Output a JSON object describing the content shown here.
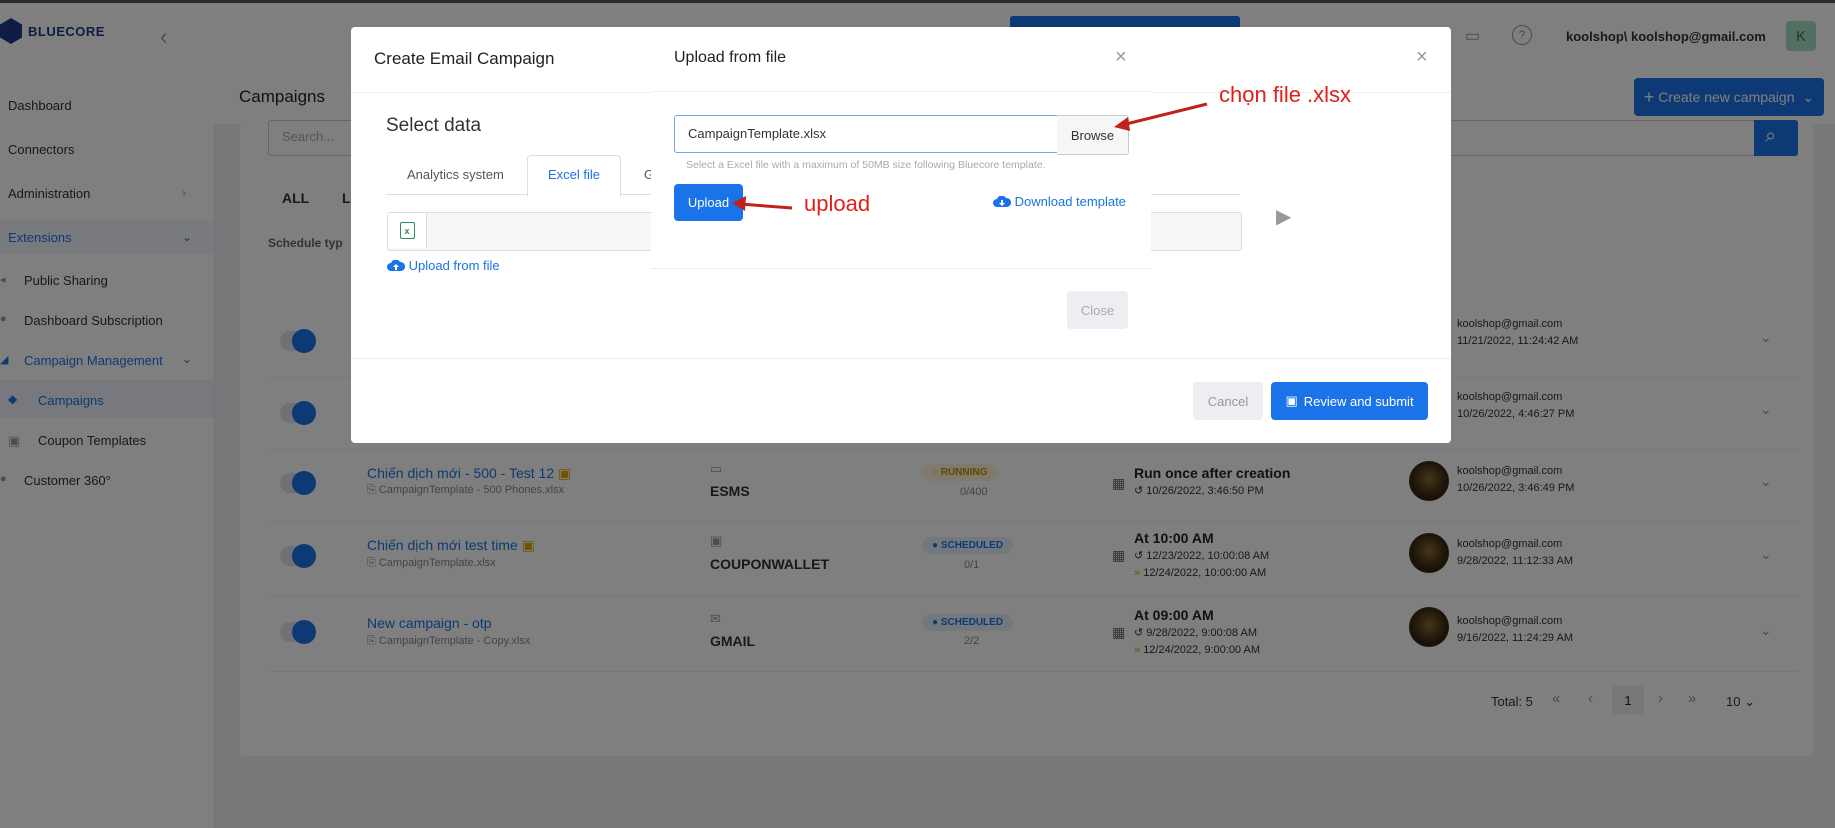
{
  "app": {
    "brand": "BLUECORE"
  },
  "header": {
    "user": "koolshop\\ koolshop@gmail.com",
    "avatar_letter": "K"
  },
  "sidebar": {
    "items": [
      {
        "label": "Dashboard"
      },
      {
        "label": "Connectors"
      },
      {
        "label": "Administration"
      },
      {
        "label": "Extensions"
      },
      {
        "label": "Public Sharing"
      },
      {
        "label": "Dashboard Subscription"
      },
      {
        "label": "Campaign Management"
      },
      {
        "label": "Campaigns"
      },
      {
        "label": "Coupon Templates"
      },
      {
        "label": "Customer 360°"
      }
    ]
  },
  "page": {
    "title": "Campaigns",
    "create_button": "Create new campaign",
    "search_placeholder": "Search...",
    "filter_all": "ALL",
    "filter_l": "L",
    "schedule_type": "Schedule typ",
    "total": "Total: 5",
    "page_number": "1",
    "page_size": "10"
  },
  "rows": [
    {
      "creator": "koolshop@gmail.com",
      "created": "11/21/2022, 11:24:42 AM"
    },
    {
      "creator": "koolshop@gmail.com",
      "created": "10/26/2022, 4:46:27 PM"
    },
    {
      "name": "Chiến dịch mới - 500 - Test 12",
      "file": "CampaignTemplate - 500 Phones.xlsx",
      "channel": "ESMS",
      "status": "RUNNING",
      "count": "0/400",
      "schedule": "Run once after creation",
      "last": "10/26/2022, 3:46:50 PM",
      "next": "",
      "creator": "koolshop@gmail.com",
      "created": "10/26/2022, 3:46:49 PM"
    },
    {
      "name": "Chiến dịch mới test time",
      "file": "CampaignTemplate.xlsx",
      "channel": "COUPONWALLET",
      "status": "SCHEDULED",
      "count": "0/1",
      "schedule": "At 10:00 AM",
      "last": "12/23/2022, 10:00:08 AM",
      "next": "12/24/2022, 10:00:00 AM",
      "creator": "koolshop@gmail.com",
      "created": "9/28/2022, 11:12:33 AM"
    },
    {
      "name": "New campaign - otp",
      "file": "CampaignTemplate - Copy.xlsx",
      "channel": "GMAIL",
      "status": "SCHEDULED",
      "count": "2/2",
      "schedule": "At 09:00 AM",
      "last": "9/28/2022, 9:00:08 AM",
      "next": "12/24/2022, 9:00:00 AM",
      "creator": "koolshop@gmail.com",
      "created": "9/16/2022, 11:24:29 AM"
    }
  ],
  "campaign_modal": {
    "title": "Create Email Campaign",
    "section": "Select data",
    "tabs": [
      "Analytics system",
      "Excel file",
      "G"
    ],
    "upload_link": "Upload from file",
    "cancel": "Cancel",
    "submit": "Review and submit"
  },
  "upload_modal": {
    "title": "Upload from file",
    "file_value": "CampaignTemplate.xlsx",
    "browse": "Browse",
    "hint": "Select a Excel file with a maximum of 50MB size following Bluecore template.",
    "upload": "Upload",
    "download": "Download template",
    "close": "Close"
  },
  "annotations": {
    "choose_file": "chọn file .xlsx",
    "upload": "upload"
  },
  "colors": {
    "accent": "#1a73e8",
    "annotation": "#e0201a",
    "running": "#c49000"
  }
}
